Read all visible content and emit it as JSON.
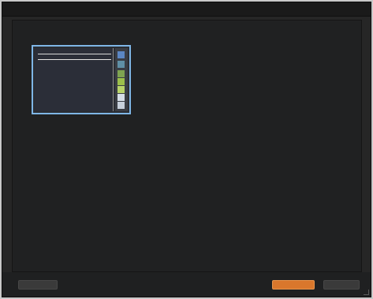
{
  "window": {
    "title": ""
  },
  "thumbnail": {
    "caption": "",
    "swatch_colors": [
      "#5b86c3",
      "#5f8fa6",
      "#7fa451",
      "#9cc04b",
      "#b9d46a",
      "#d5dde6",
      "#c7d0db"
    ]
  },
  "footer": {
    "left_button_label": "",
    "link_label": "",
    "primary_button_label": "",
    "secondary_button_label": ""
  },
  "colors": {
    "background": "#262626",
    "accent_orange": "#d9772c",
    "selection_blue": "#7fb6e6"
  }
}
